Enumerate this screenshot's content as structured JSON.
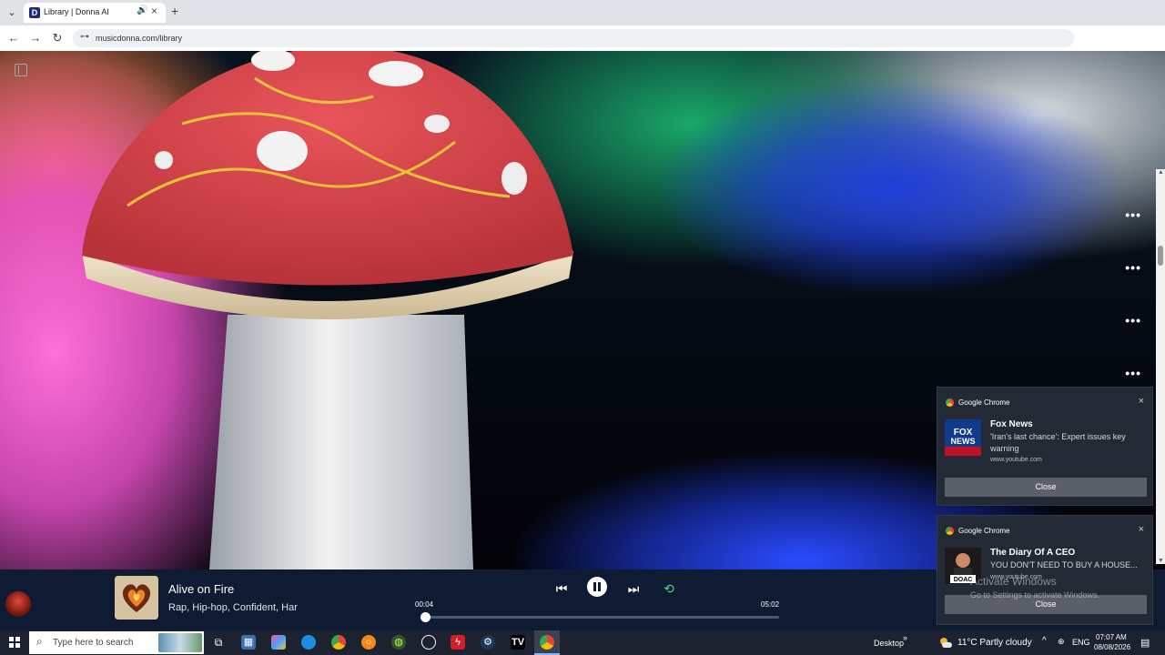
{
  "browser": {
    "tab_list_icon": "chevron-down-icon",
    "tab": {
      "favicon_letter": "D",
      "title": "Library | Donna AI",
      "audio_icon": "speaker-icon",
      "close_icon": "close-icon"
    },
    "new_tab_icon": "plus-icon",
    "nav": {
      "back_icon": "arrow-left-icon",
      "forward_icon": "arrow-right-icon",
      "reload_icon": "reload-icon",
      "site_info_icon": "site-info-icon"
    },
    "url": "musicdonna.com/library"
  },
  "page": {
    "sidebar_toggle_icon": "sidebar-toggle-icon",
    "more_label": "•••"
  },
  "player": {
    "track_title": "Alive on Fire",
    "track_tags": "Rap, Hip-hop, Confident, Har",
    "elapsed": "00:04",
    "duration": "05:02",
    "progress_fraction": 0.013,
    "icons": {
      "prev": "skip-previous-icon",
      "play_pause": "pause-icon",
      "next": "skip-next-icon",
      "repeat": "repeat-icon"
    }
  },
  "notifications": [
    {
      "app": "Google Chrome",
      "title": "Fox News",
      "body": "'Iran's last chance': Expert issues key warning",
      "source": "www.youtube.com",
      "button": "Close",
      "thumb_text": "FOX NEWS"
    },
    {
      "app": "Google Chrome",
      "title": "The Diary Of A CEO",
      "body": "YOU DON'T NEED TO BUY A HOUSE...",
      "source": "www.youtube.com",
      "button": "Close",
      "thumb_text": "DOAC"
    }
  ],
  "watermark": {
    "title": "Activate Windows",
    "subtitle": "Go to Settings to activate Windows."
  },
  "taskbar": {
    "search_placeholder": "Type here to search",
    "desktop_label": "Desktop",
    "weather": "11°C  Partly cloudy",
    "language": "ENG",
    "time": "07:07 AM",
    "date": "08/08/2026"
  },
  "colors": {
    "player_bg": "#0f1a33",
    "toast_bg": "#242a35",
    "taskbar_bg": "#1d2230",
    "accent": "#8ab4f8"
  }
}
